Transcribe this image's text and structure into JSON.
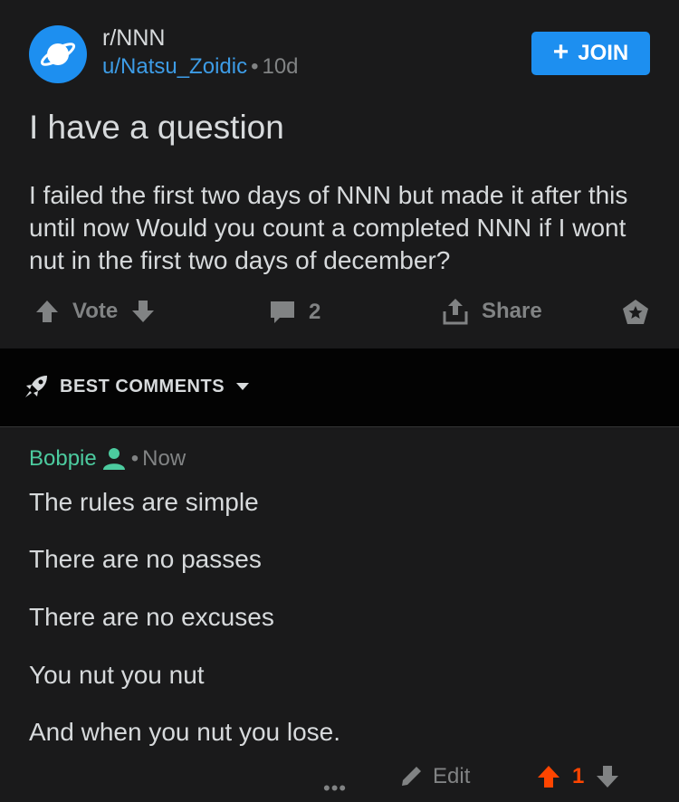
{
  "post": {
    "subreddit": "r/NNN",
    "author": "u/Natsu_Zoidic",
    "separator": "•",
    "age": "10d",
    "join_label": "JOIN",
    "title": "I have a question",
    "body": "I failed the first two days of NNN but made it after this until now Would you count a completed NNN if I wont nut in the first two days of december?",
    "vote_label": "Vote",
    "comment_count": "2",
    "share_label": "Share"
  },
  "sort": {
    "label": "BEST COMMENTS"
  },
  "comment": {
    "author": "Bobpie",
    "separator": "•",
    "time": "Now",
    "lines": [
      "The rules are simple",
      "There are no passes",
      "There are no excuses",
      "You nut you nut",
      "And when you nut you lose."
    ],
    "more_label": "•••",
    "edit_label": "Edit",
    "score": "1"
  },
  "colors": {
    "accent_blue": "#1d8ff0",
    "author_blue": "#3d9ce6",
    "mod_green": "#4ccb9f",
    "upvote_orange": "#ff4500",
    "muted": "#818384"
  }
}
